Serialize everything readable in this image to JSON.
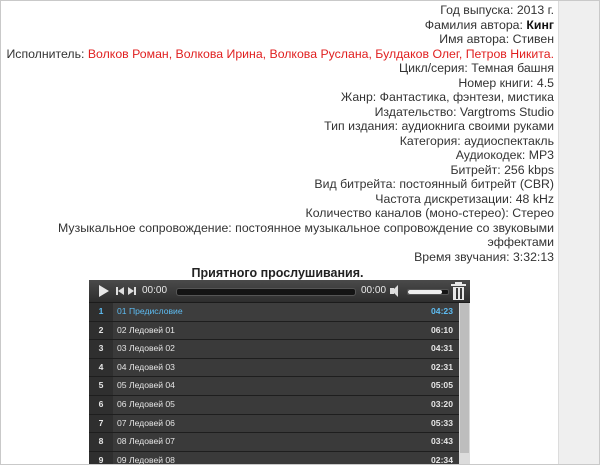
{
  "info": [
    {
      "label": "Год выпуска:",
      "value": "2013 г."
    },
    {
      "label": "Фамилия автора:",
      "value": "Кинг"
    },
    {
      "label": "Имя автора:",
      "value": "Стивен"
    },
    {
      "label": "Исполнитель:",
      "value": "Волков Роман, Волкова Ирина, Волкова Руслана, Булдаков Олег, Петров Никита."
    },
    {
      "label": "Цикл/серия:",
      "value": "Темная башня"
    },
    {
      "label": "Номер книги:",
      "value": "4.5"
    },
    {
      "label": "Жанр:",
      "value": "Фантастика, фэнтези, мистика"
    },
    {
      "label": "Издательство:",
      "value": "Vargtroms Studio"
    },
    {
      "label": "Тип издания:",
      "value": "аудиокнига своими руками"
    },
    {
      "label": "Категория:",
      "value": "аудиоспектакль"
    },
    {
      "label": "Аудиокодек:",
      "value": "MP3"
    },
    {
      "label": "Битрейт:",
      "value": "256 kbps"
    },
    {
      "label": "Вид битрейта:",
      "value": "постоянный битрейт (CBR)"
    },
    {
      "label": "Частота дискретизации:",
      "value": "48 kHz"
    },
    {
      "label": "Количество каналов (моно-стерео):",
      "value": "Стерео"
    },
    {
      "label": "Музыкальное сопровождение:",
      "value": "постоянное музыкальное сопровождение со звуковыми эффектами"
    },
    {
      "label": "Время звучания:",
      "value": "3:32:13"
    }
  ],
  "greeting": "Приятного прослушивания.",
  "player": {
    "current_time": "00:00",
    "duration": "00:00",
    "volume_fraction": 0.85,
    "tracks": [
      {
        "num": "1",
        "title": "01 Предисловие",
        "duration": "04:23",
        "active": true
      },
      {
        "num": "2",
        "title": "02 Ледовей 01",
        "duration": "06:10"
      },
      {
        "num": "3",
        "title": "03 Ледовей 02",
        "duration": "04:31"
      },
      {
        "num": "4",
        "title": "04 Ледовей 03",
        "duration": "02:31"
      },
      {
        "num": "5",
        "title": "05 Ледовей 04",
        "duration": "05:05"
      },
      {
        "num": "6",
        "title": "06 Ледовей 05",
        "duration": "03:20"
      },
      {
        "num": "7",
        "title": "07 Ледовей 06",
        "duration": "05:33"
      },
      {
        "num": "8",
        "title": "08 Ледовей 07",
        "duration": "03:43"
      },
      {
        "num": "9",
        "title": "09 Ледовей 08",
        "duration": "02:34"
      }
    ]
  },
  "colors": {
    "performer": "#e01f1f",
    "active_track": "#5dbcf2"
  }
}
